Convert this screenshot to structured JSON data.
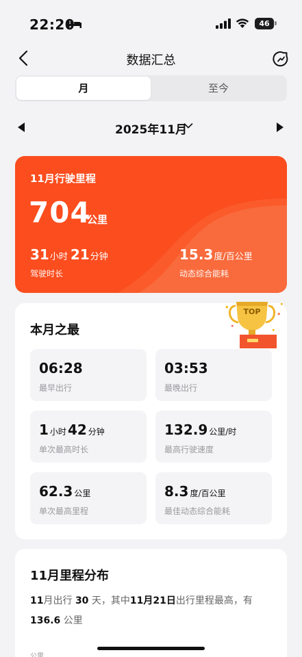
{
  "status_bar": {
    "time": "22:20",
    "battery": "46"
  },
  "nav": {
    "title": "数据汇总"
  },
  "segments": {
    "active": "月",
    "inactive": "至今"
  },
  "month_picker": {
    "label": "2025年11月"
  },
  "hero": {
    "title": "11月行驶里程",
    "distance": "704",
    "distance_unit": "公里",
    "hours": "31",
    "hours_unit": "小时",
    "minutes": "21",
    "minutes_unit": "分钟",
    "duration_label": "驾驶时长",
    "energy": "15.3",
    "energy_unit": "度/百公里",
    "energy_label": "动态综合能耗"
  },
  "best": {
    "title": "本月之最",
    "trophy_text": "TOP",
    "earliest": {
      "value": "06:28",
      "label": "最早出行"
    },
    "latest": {
      "value": "03:53",
      "label": "最晚出行"
    },
    "longest": {
      "hours": "1",
      "hours_unit": "小时",
      "minutes": "42",
      "minutes_unit": "分钟",
      "label": "单次最高时长"
    },
    "top_speed": {
      "value": "132.9",
      "unit": "公里/时",
      "label": "最高行驶速度"
    },
    "max_distance": {
      "value": "62.3",
      "unit": "公里",
      "label": "单次最高里程"
    },
    "best_energy": {
      "value": "8.3",
      "unit": "度/百公里",
      "label": "最佳动态综合能耗"
    }
  },
  "distribution": {
    "title": "11月里程分布",
    "p1": "11",
    "p2": "月出行",
    "p3": "30",
    "p4": "天，其中",
    "p5": "11月21日",
    "p6": "出行里程最高，有",
    "p7": "136.6",
    "p8": "公里",
    "unit_label": "公里"
  },
  "colors": {
    "hero_orange": "#fb4d1e",
    "hero_wave": "#f96a3c"
  }
}
